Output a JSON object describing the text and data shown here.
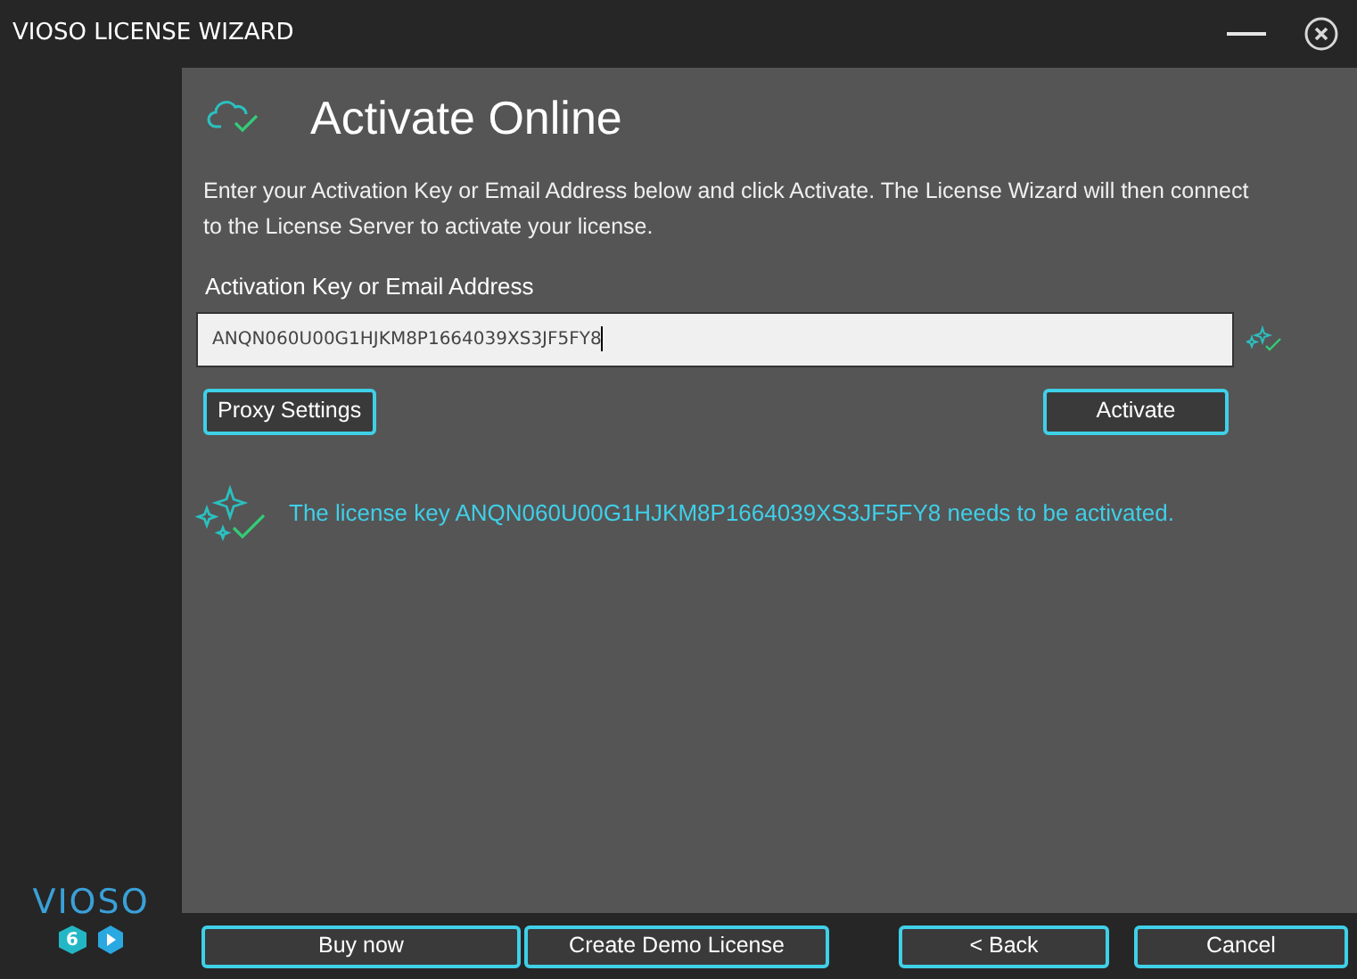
{
  "window": {
    "title": "VIOSO LICENSE WIZARD"
  },
  "page": {
    "title": "Activate Online",
    "description": "Enter your Activation Key or Email Address below and click Activate. The License Wizard will then connect to the License Server to activate your license."
  },
  "activation_field": {
    "label": "Activation Key or Email Address",
    "value": "ANQN060U00G1HJKM8P1664039XS3JF5FY8"
  },
  "buttons": [
    "Proxy Settings",
    "Activate"
  ],
  "status_message": "The license key ANQN060U00G1HJKM8P1664039XS3JF5FY8 needs to be activated.",
  "logo": {
    "text": "VIOSO",
    "version": "6"
  },
  "footer_buttons": [
    "Buy now",
    "Create Demo License",
    "< Back",
    "Cancel"
  ]
}
